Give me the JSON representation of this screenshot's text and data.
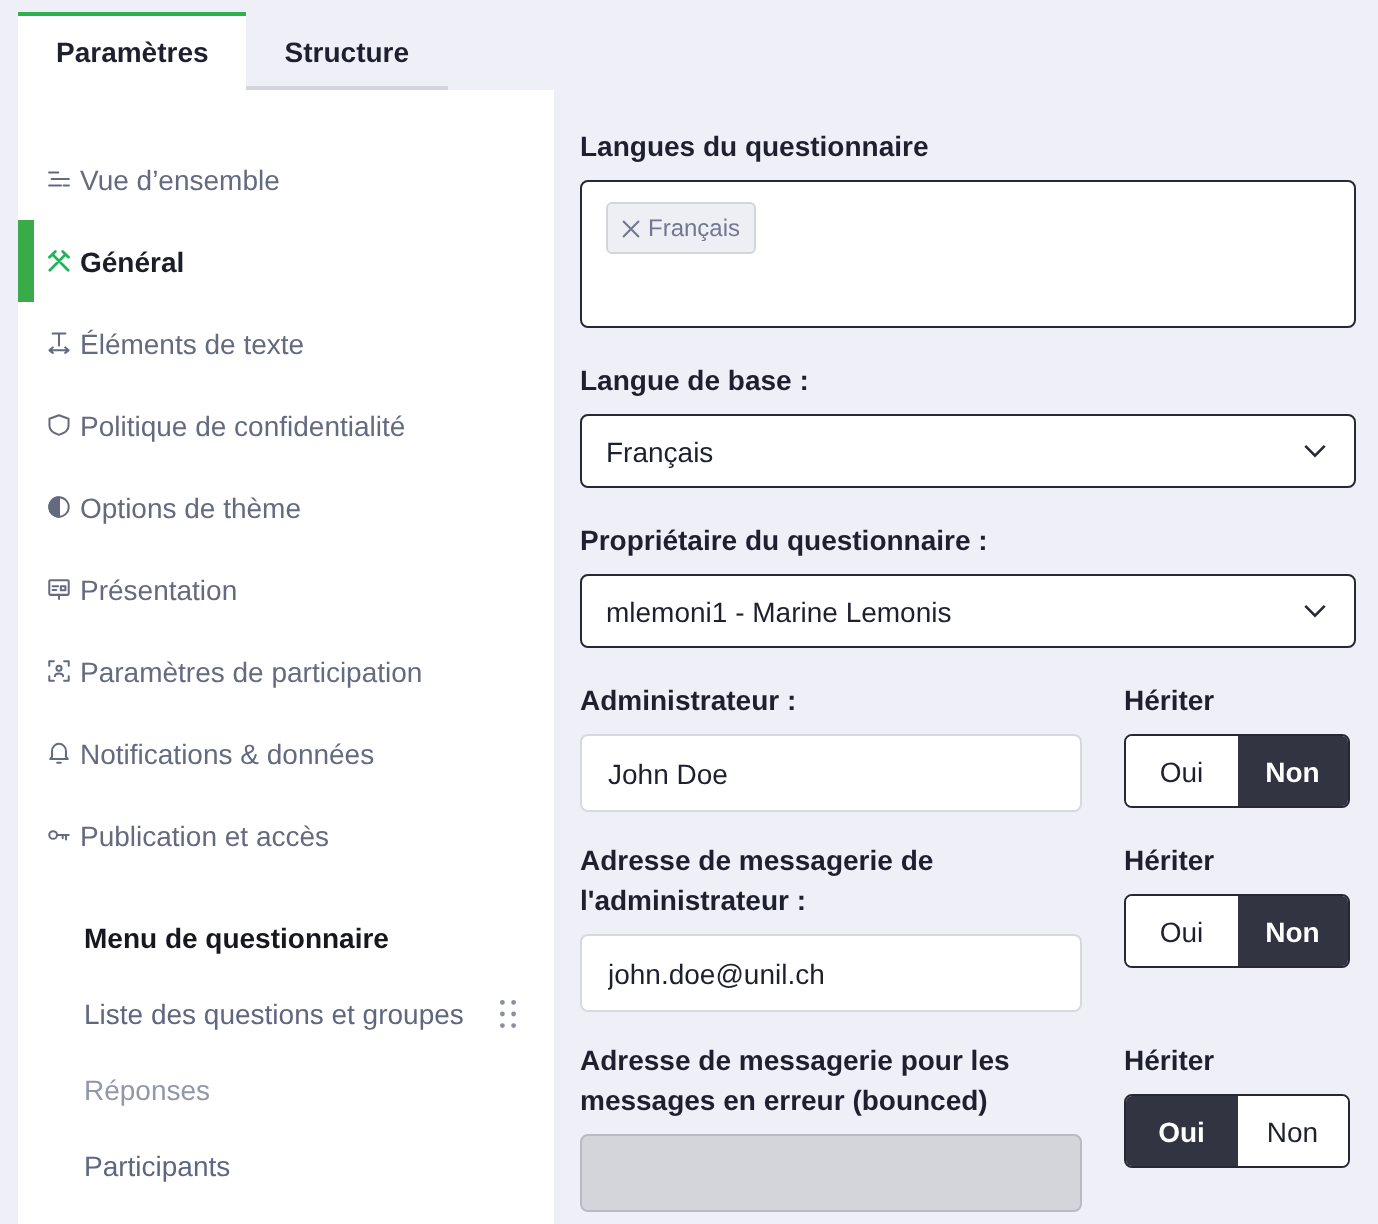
{
  "tabs": [
    {
      "label": "Paramètres",
      "selected": true
    },
    {
      "label": "Structure",
      "selected": false
    }
  ],
  "sidebar": {
    "items": [
      {
        "kind": "overview",
        "label": "Vue d’ensemble",
        "selected": false
      },
      {
        "kind": "general",
        "label": "Général",
        "selected": true
      },
      {
        "kind": "text",
        "label": "Éléments de texte",
        "selected": false
      },
      {
        "kind": "privacy",
        "label": "Politique de confidentialité",
        "selected": false
      },
      {
        "kind": "theme",
        "label": "Options de thème",
        "selected": false
      },
      {
        "kind": "presentation",
        "label": "Présentation",
        "selected": false
      },
      {
        "kind": "participation",
        "label": "Paramètres de participation",
        "selected": false
      },
      {
        "kind": "notifications",
        "label": "Notifications & données",
        "selected": false
      },
      {
        "kind": "publication",
        "label": "Publication et accès",
        "selected": false
      }
    ],
    "menu": {
      "title": "Menu de questionnaire",
      "items": [
        {
          "label": "Liste des questions et groupes",
          "disabled": false,
          "drag_handle": true
        },
        {
          "label": "Réponses",
          "disabled": true,
          "drag_handle": false
        },
        {
          "label": "Participants",
          "disabled": false,
          "drag_handle": false
        }
      ]
    }
  },
  "form": {
    "languages": {
      "label": "Langues du questionnaire",
      "tags": [
        "Français"
      ]
    },
    "base_language": {
      "label": "Langue de base :",
      "value": "Français"
    },
    "owner": {
      "label": "Propriétaire du questionnaire :",
      "value": "mlemoni1 - Marine Lemonis"
    },
    "inherit_rows": [
      {
        "label": "Administrateur :",
        "value": "John Doe",
        "disabled": false,
        "inherit": {
          "label": "Hériter",
          "options": [
            {
              "label": "Oui",
              "selected": false
            },
            {
              "label": "Non",
              "selected": true
            }
          ]
        }
      },
      {
        "label": "Adresse de messagerie de l'administrateur :",
        "value": "john.doe@unil.ch",
        "disabled": false,
        "inherit": {
          "label": "Hériter",
          "options": [
            {
              "label": "Oui",
              "selected": false
            },
            {
              "label": "Non",
              "selected": true
            }
          ]
        }
      },
      {
        "label": "Adresse de messagerie pour les messages en erreur (bounced)",
        "disabled": true,
        "inherit": {
          "label": "Hériter",
          "options": [
            {
              "label": "Oui",
              "selected": true
            },
            {
              "label": "Non",
              "selected": false
            }
          ]
        }
      }
    ]
  }
}
